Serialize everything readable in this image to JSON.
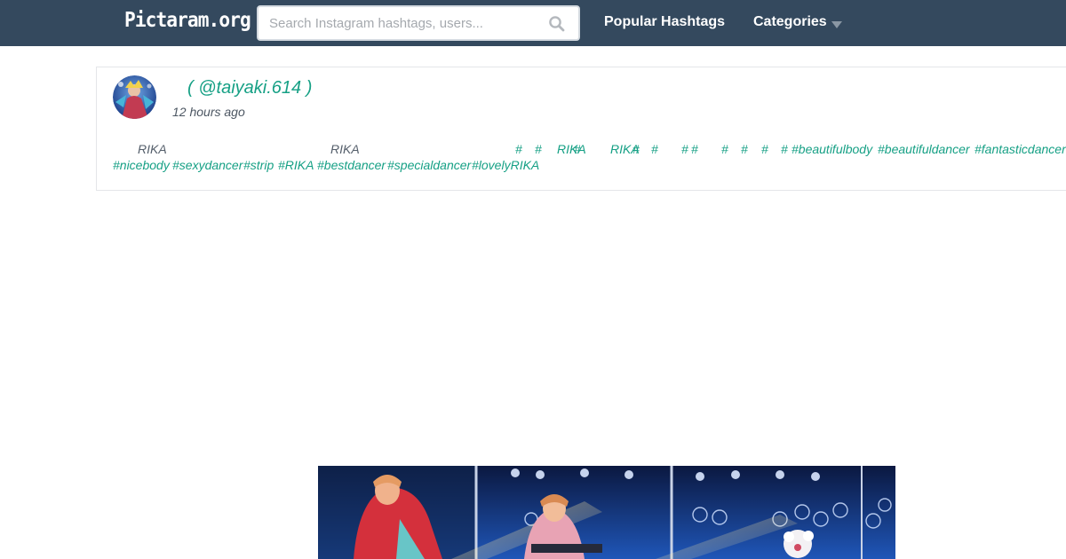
{
  "brand": {
    "logo": "Pictaram.org"
  },
  "search": {
    "placeholder": "Search Instagram hashtags, users..."
  },
  "nav": {
    "popular": "Popular Hashtags",
    "categories": "Categories"
  },
  "post": {
    "username": "( @taiyaki.614 )",
    "time": "12 hours ago",
    "caption": {
      "rika1": "RIKA",
      "rika2": "RIKA",
      "hash": "#",
      "rika_tag": "RIKA",
      "beautifulbody": "#beautifulbody",
      "beautifuldancer": "#beautifuldancer",
      "fantasticdancer": "#fantasticdancer",
      "nicebody": "#nicebody",
      "sexydancer": "#sexydancer",
      "strip": "#strip",
      "RIKA": "#RIKA",
      "bestdancer": "#bestdancer",
      "specialdancer": "#specialdancer",
      "lovelyRIKA": "#lovelyRIKA"
    }
  },
  "colors": {
    "navbar": "#34495e",
    "accent": "#16a085",
    "text": "#4c5662"
  }
}
